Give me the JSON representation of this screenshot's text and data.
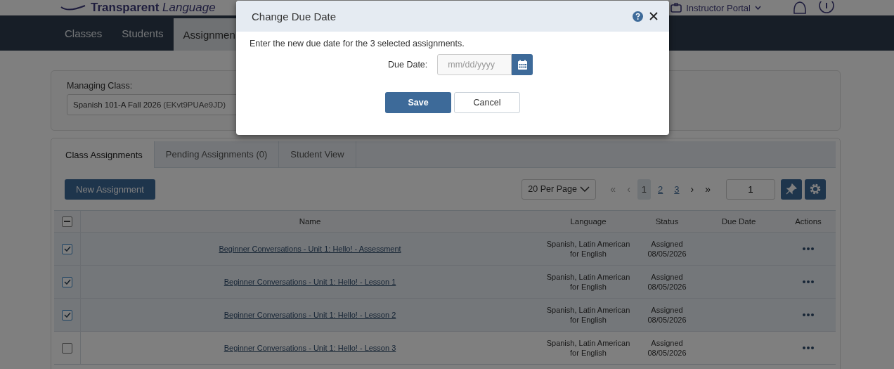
{
  "header": {
    "logo": "**Transparent** *Language*",
    "portal_menu": "Instructor Portal"
  },
  "nav": [
    {
      "label": "Classes",
      "selected": false
    },
    {
      "label": "Students",
      "selected": false
    },
    {
      "label": "Assignmen",
      "selected": true
    }
  ],
  "managing_class": {
    "label": "Managing Class:",
    "value": "Spanish 101-A Fall 2026",
    "code": "(EKvt9PUAe9JD)"
  },
  "tabs": [
    {
      "label": "Class Assignments",
      "selected": true
    },
    {
      "label": "Pending Assignments (0)",
      "selected": false
    },
    {
      "label": "Student View",
      "selected": false
    }
  ],
  "new_assignment_button": "New Assignment",
  "pagination": {
    "per_page": "20 Per Page",
    "first": "«",
    "prev": "‹",
    "pages": [
      {
        "label": "1",
        "selected": true
      },
      {
        "label": "2",
        "selected": false
      },
      {
        "label": "3",
        "selected": false
      }
    ],
    "next": "›",
    "last": "»",
    "page_input": "1"
  },
  "table": {
    "select_all_indeterminate": true,
    "columns": [
      "Name",
      "Language",
      "Status",
      "Due Date",
      "Actions"
    ],
    "rows": [
      {
        "checked": true,
        "name": "Beginner Conversations - Unit 1: Hello! - Assessment",
        "language": "Spanish, Latin American for English",
        "status": "Assigned",
        "assigned_date": "08/05/2026"
      },
      {
        "checked": true,
        "name": "Beginner Conversations - Unit 1: Hello! - Lesson 1",
        "language": "Spanish, Latin American for English",
        "status": "Assigned",
        "assigned_date": "08/05/2026"
      },
      {
        "checked": true,
        "name": "Beginner Conversations - Unit 1: Hello! - Lesson 2",
        "language": "Spanish, Latin American for English",
        "status": "Assigned",
        "assigned_date": "08/05/2026"
      },
      {
        "checked": false,
        "name": "Beginner Conversations - Unit 1: Hello! - Lesson 3",
        "language": "Spanish, Latin American for English",
        "status": "Assigned",
        "assigned_date": "08/05/2026"
      }
    ]
  },
  "dialog": {
    "title": "Change Due Date",
    "message": "Enter the new due date for the 3 selected assignments.",
    "field_label": "Due Date:",
    "placeholder": "mm/dd/yyyy",
    "buttons": [
      {
        "label": "Save",
        "kind": "primary"
      },
      {
        "label": "Cancel",
        "kind": "secondary"
      }
    ]
  }
}
